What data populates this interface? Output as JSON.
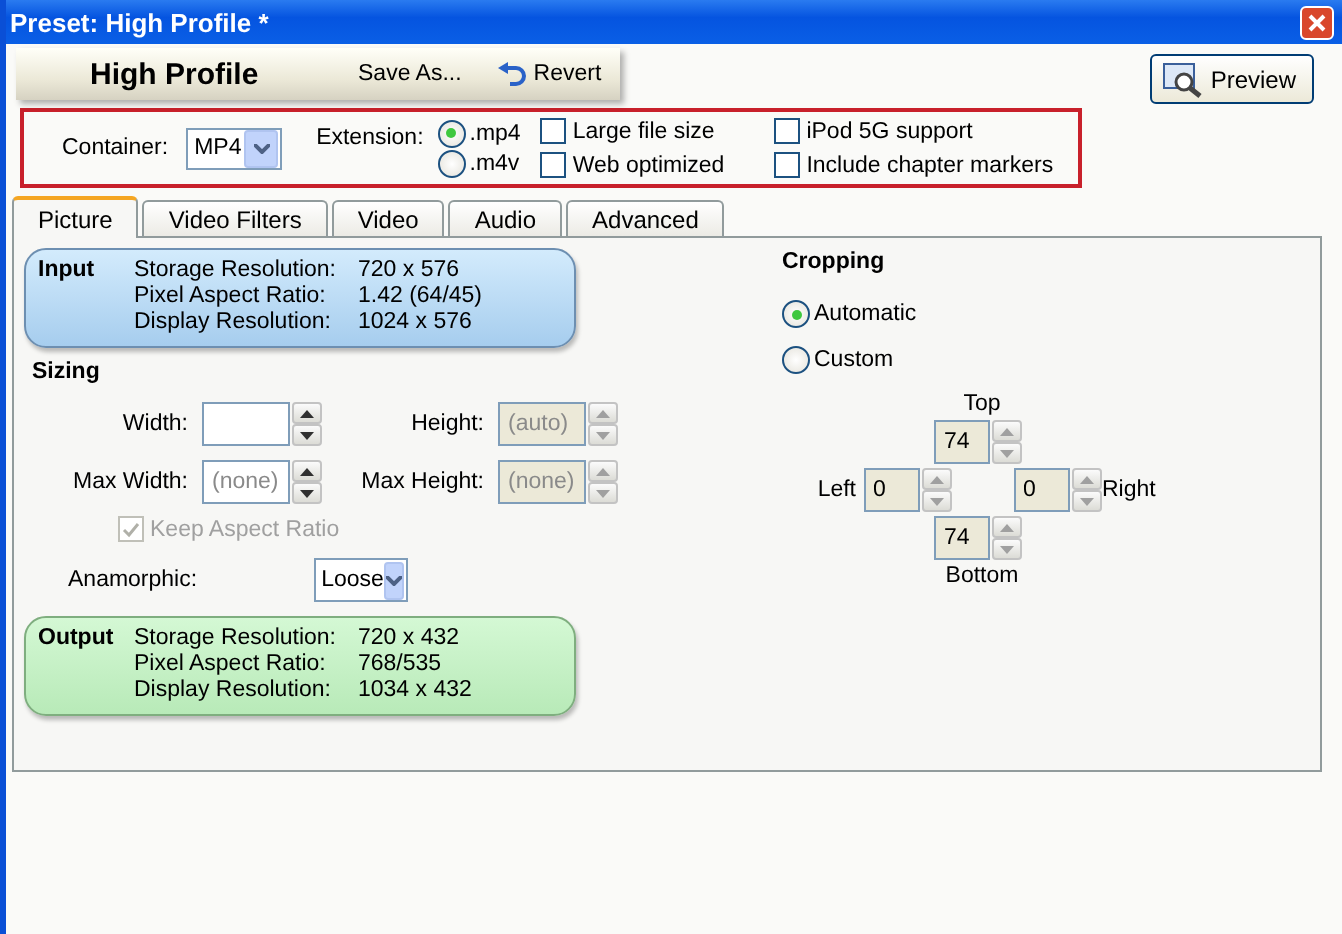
{
  "window": {
    "title": "Preset: High Profile *"
  },
  "toolbar": {
    "preset_name": "High Profile",
    "save_as": "Save As...",
    "revert": "Revert",
    "preview": "Preview"
  },
  "settings": {
    "container_label": "Container:",
    "container_value": "MP4",
    "extension_label": "Extension:",
    "extensions": [
      {
        "label": ".mp4",
        "selected": true
      },
      {
        "label": ".m4v",
        "selected": false
      }
    ],
    "options": [
      {
        "label": "Large file size",
        "checked": false
      },
      {
        "label": "Web optimized",
        "checked": false
      },
      {
        "label": "iPod 5G support",
        "checked": false
      },
      {
        "label": "Include chapter markers",
        "checked": false
      }
    ]
  },
  "tabs": [
    {
      "label": "Picture",
      "selected": true
    },
    {
      "label": "Video Filters",
      "selected": false
    },
    {
      "label": "Video",
      "selected": false
    },
    {
      "label": "Audio",
      "selected": false
    },
    {
      "label": "Advanced",
      "selected": false
    }
  ],
  "picture": {
    "input": {
      "title": "Input",
      "rows": [
        {
          "label": "Storage Resolution:",
          "value": "720 x 576"
        },
        {
          "label": "Pixel Aspect Ratio:",
          "value": "1.42 (64/45)"
        },
        {
          "label": "Display Resolution:",
          "value": "1024 x 576"
        }
      ]
    },
    "sizing": {
      "title": "Sizing",
      "fields": [
        {
          "label": "Width:",
          "disabled": false
        },
        {
          "label": "Height:",
          "placeholder": "(auto)",
          "disabled": true
        },
        {
          "label": "Max Width:",
          "placeholder": "(none)",
          "disabled": false
        },
        {
          "label": "Max Height:",
          "placeholder": "(none)",
          "disabled": true
        }
      ],
      "keep_aspect": {
        "label": "Keep Aspect Ratio",
        "checked": true,
        "disabled": true
      },
      "anamorphic": {
        "label": "Anamorphic:",
        "value": "Loose"
      }
    },
    "output": {
      "title": "Output",
      "rows": [
        {
          "label": "Storage Resolution:",
          "value": "720 x 432"
        },
        {
          "label": "Pixel Aspect Ratio:",
          "value": "768/535"
        },
        {
          "label": "Display Resolution:",
          "value": "1034 x 432"
        }
      ]
    },
    "cropping": {
      "title": "Cropping",
      "modes": [
        {
          "label": "Automatic",
          "selected": true
        },
        {
          "label": "Custom",
          "selected": false
        }
      ],
      "top": {
        "label": "Top",
        "value": "74",
        "disabled": true
      },
      "left": {
        "label": "Left",
        "value": "0",
        "disabled": true
      },
      "right": {
        "label": "Right",
        "value": "0",
        "disabled": true
      },
      "bottom": {
        "label": "Bottom",
        "value": "74",
        "disabled": true
      }
    }
  }
}
